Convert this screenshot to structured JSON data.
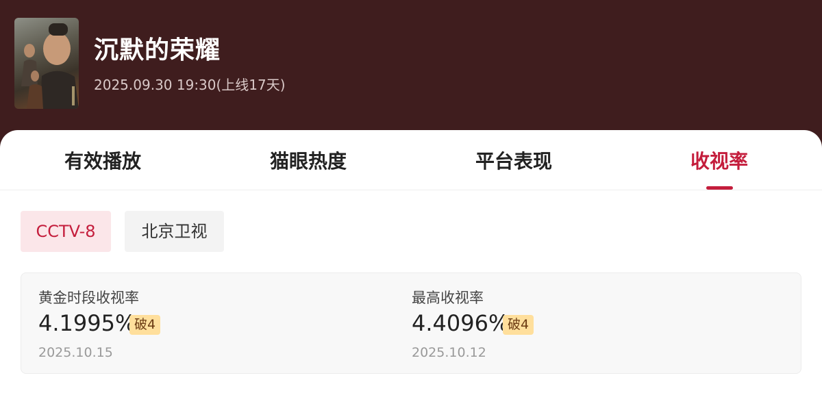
{
  "header": {
    "title": "沉默的荣耀",
    "meta": "2025.09.30 19:30(上线17天)"
  },
  "tabs": [
    {
      "label": "有效播放",
      "active": false
    },
    {
      "label": "猫眼热度",
      "active": false
    },
    {
      "label": "平台表现",
      "active": false
    },
    {
      "label": "收视率",
      "active": true
    }
  ],
  "channels": [
    {
      "label": "CCTV-8",
      "active": true
    },
    {
      "label": "北京卫视",
      "active": false
    }
  ],
  "stats": [
    {
      "label": "黄金时段收视率",
      "value": "4.1995%",
      "badge": "破4",
      "date": "2025.10.15"
    },
    {
      "label": "最高收视率",
      "value": "4.4096%",
      "badge": "破4",
      "date": "2025.10.12"
    }
  ],
  "colors": {
    "header_bg": "#3f1d1e",
    "accent": "#c41d3c",
    "badge_bg": "#ffdf9c"
  }
}
